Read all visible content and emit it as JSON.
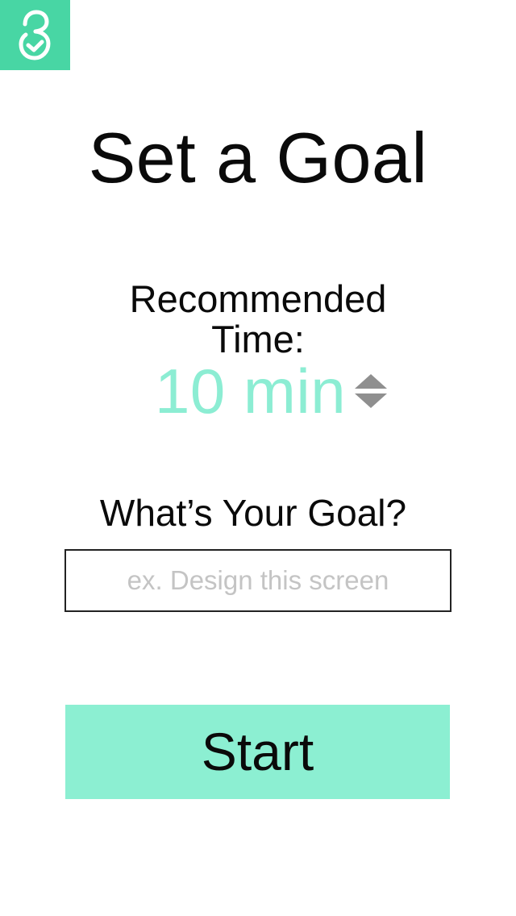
{
  "app": {
    "logo_icon": "app-logo-icon",
    "accent_color": "#48d6a4",
    "light_accent_color": "#8cefd2"
  },
  "header": {
    "title": "Set a Goal"
  },
  "recommended": {
    "label_line1": "Recommended",
    "label_line2": "Time:",
    "value": "10 min",
    "stepper_icon": "up-down-stepper-icon"
  },
  "goal": {
    "label": "What’s Your Goal?",
    "input_value": "",
    "input_placeholder": "ex. Design this screen"
  },
  "actions": {
    "start_label": "Start"
  }
}
